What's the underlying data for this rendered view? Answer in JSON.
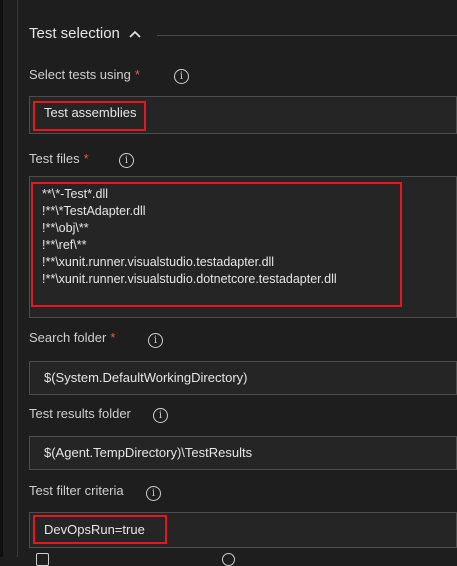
{
  "section": {
    "title": "Test selection",
    "chevron_icon": "chevron-up-icon"
  },
  "fields": {
    "select_tests_using": {
      "label": "Select tests using",
      "required_mark": "*",
      "value": "Test assemblies"
    },
    "test_files": {
      "label": "Test files",
      "required_mark": "*",
      "lines": [
        "**\\*-Test*.dll",
        "!**\\*TestAdapter.dll",
        "!**\\obj\\**",
        "!**\\ref\\**",
        "!**\\xunit.runner.visualstudio.testadapter.dll",
        "!**\\xunit.runner.visualstudio.dotnetcore.testadapter.dll"
      ]
    },
    "search_folder": {
      "label": "Search folder",
      "required_mark": "*",
      "value": "$(System.DefaultWorkingDirectory)"
    },
    "test_results_folder": {
      "label": "Test results folder",
      "value": "$(Agent.TempDirectory)\\TestResults"
    },
    "test_filter_criteria": {
      "label": "Test filter criteria",
      "value": "DevOpsRun=true"
    }
  },
  "info_icon_glyph": "i",
  "colors": {
    "background": "#1e1e1e",
    "field_background": "#252526",
    "required": "#e05b5b",
    "highlight": "#e8141e"
  }
}
